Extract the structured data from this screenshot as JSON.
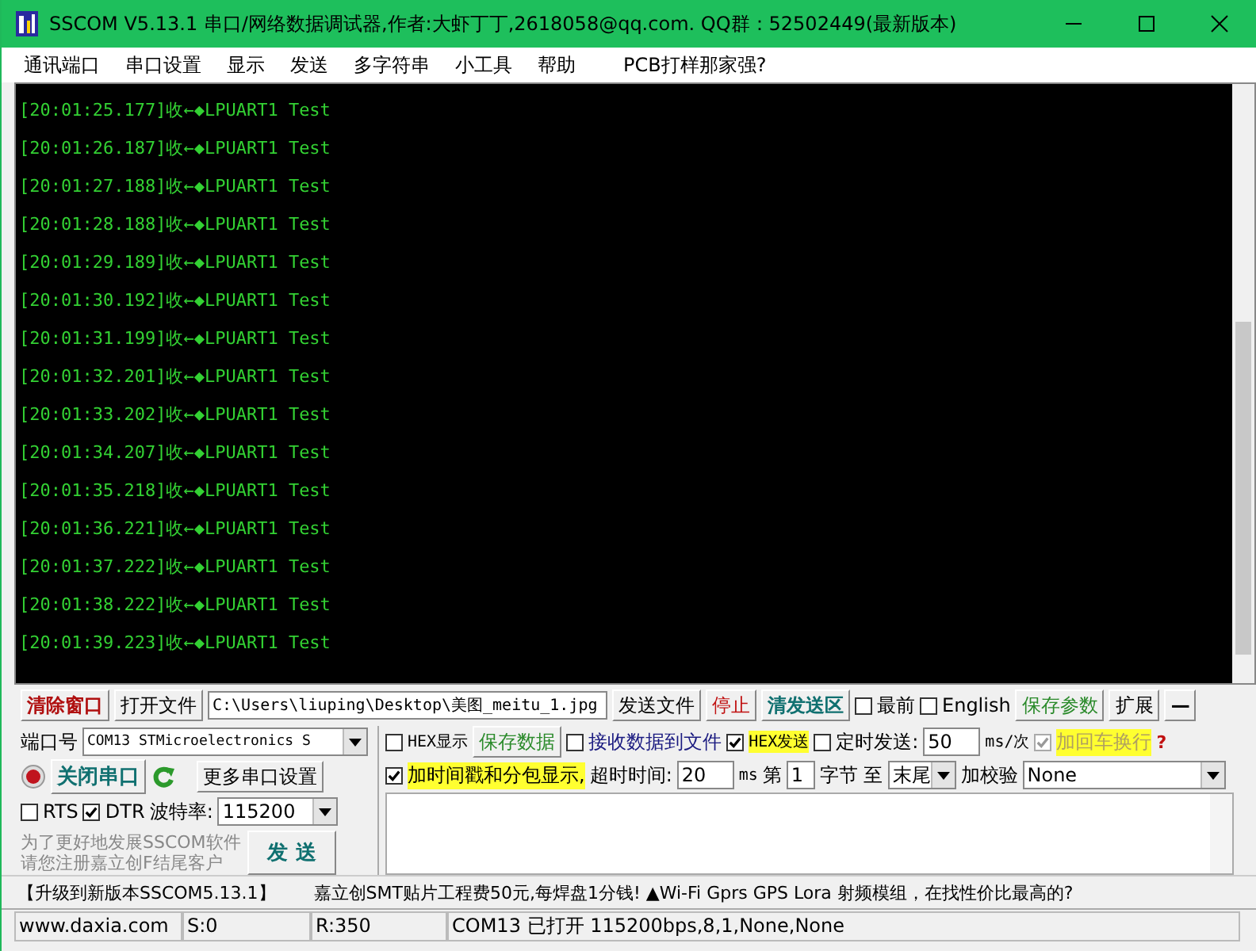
{
  "window": {
    "title": "SSCOM V5.13.1 串口/网络数据调试器,作者:大虾丁丁,2618058@qq.com. QQ群：52502449(最新版本)"
  },
  "menu": [
    "通讯端口",
    "串口设置",
    "显示",
    "发送",
    "多字符串",
    "小工具",
    "帮助",
    "PCB打样那家强?"
  ],
  "terminal": {
    "lines": [
      "[20:01:25.177]收←◆LPUART1 Test",
      "[20:01:26.187]收←◆LPUART1 Test",
      "[20:01:27.188]收←◆LPUART1 Test",
      "[20:01:28.188]收←◆LPUART1 Test",
      "[20:01:29.189]收←◆LPUART1 Test",
      "[20:01:30.192]收←◆LPUART1 Test",
      "[20:01:31.199]收←◆LPUART1 Test",
      "[20:01:32.201]收←◆LPUART1 Test",
      "[20:01:33.202]收←◆LPUART1 Test",
      "[20:01:34.207]收←◆LPUART1 Test",
      "[20:01:35.218]收←◆LPUART1 Test",
      "[20:01:36.221]收←◆LPUART1 Test",
      "[20:01:37.222]收←◆LPUART1 Test",
      "[20:01:38.222]收←◆LPUART1 Test",
      "[20:01:39.223]收←◆LPUART1 Test"
    ]
  },
  "toolbar": {
    "clear_button": "清除窗口",
    "open_file_button": "打开文件",
    "file_path": "C:\\Users\\liuping\\Desktop\\美图_meitu_1.jpg",
    "send_file_button": "发送文件",
    "stop_button": "停止",
    "clear_send_button": "清发送区",
    "topmost": {
      "label": "最前",
      "checked": false
    },
    "english": {
      "label": "English",
      "checked": false
    },
    "save_params_button": "保存参数",
    "expand_button": "扩展",
    "collapse_button": "—"
  },
  "port_panel": {
    "port_label": "端口号",
    "port_value": "COM13 STMicroelectronics S",
    "close_port_button": "关闭串口",
    "more_settings_button": "更多串口设置",
    "rts": {
      "label": "RTS",
      "checked": false
    },
    "dtr": {
      "label": "DTR",
      "checked": true
    },
    "baud_label": "波特率:",
    "baud_value": "115200",
    "register_note": [
      "为了更好地发展SSCOM软件",
      "请您注册嘉立创F结尾客户"
    ],
    "send_button": "发  送"
  },
  "options": {
    "hex_display": {
      "label": "HEX显示",
      "checked": false
    },
    "save_data_button": "保存数据",
    "receive_to_file": {
      "label": "接收数据到文件",
      "checked": false
    },
    "hex_send": {
      "label": "HEX发送",
      "checked": true
    },
    "timed_send": {
      "label": "定时发送:",
      "checked": false
    },
    "interval": "50",
    "interval_unit": "ms/次",
    "add_crlf": {
      "label": "加回车换行",
      "checked": true,
      "disabled": true
    },
    "help": "?",
    "timestamp": {
      "label": "加时间戳和分包显示,",
      "checked": true
    },
    "timeout_label": "超时时间:",
    "timeout": "20",
    "timeout_unit": "ms",
    "byte_from_label": "第",
    "byte_from": "1",
    "byte_to_label": "字节 至",
    "byte_to": "末尾",
    "checksum_label": "加校验",
    "checksum": "None"
  },
  "marquee": {
    "upgrade": "【升级到新版本SSCOM5.13.1】",
    "ad": "嘉立创SMT贴片工程费50元,每焊盘1分钱! ▲Wi-Fi Gprs GPS Lora 射频模组，在找性价比最高的?"
  },
  "status_bar": [
    "www.daxia.com",
    "S:0",
    "R:350",
    "COM13 已打开  115200bps,8,1,None,None"
  ]
}
